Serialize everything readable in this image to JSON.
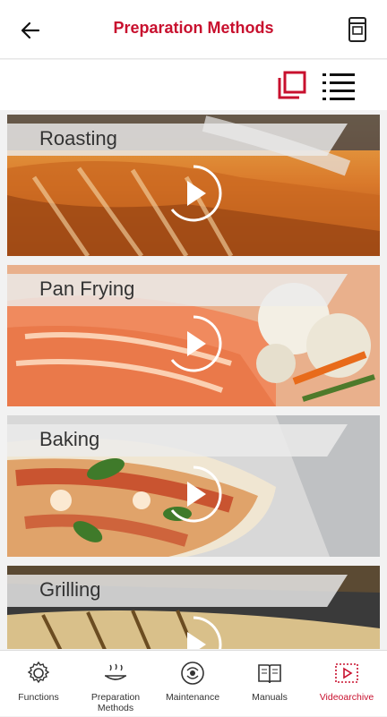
{
  "header": {
    "title": "Preparation Methods"
  },
  "videos": [
    {
      "label": "Roasting",
      "image": "roast-pork"
    },
    {
      "label": "Pan Frying",
      "image": "salmon-fillets"
    },
    {
      "label": "Baking",
      "image": "pizza"
    },
    {
      "label": "Grilling",
      "image": "grilled-food"
    }
  ],
  "tabs": [
    {
      "label": "Functions",
      "icon": "gear-icon"
    },
    {
      "label": "Preparation Methods",
      "icon": "steam-pan-icon"
    },
    {
      "label": "Maintenance",
      "icon": "cleaning-icon"
    },
    {
      "label": "Manuals",
      "icon": "book-icon"
    },
    {
      "label": "Videoarchive",
      "icon": "video-icon"
    }
  ],
  "colors": {
    "accent": "#c8102e"
  }
}
